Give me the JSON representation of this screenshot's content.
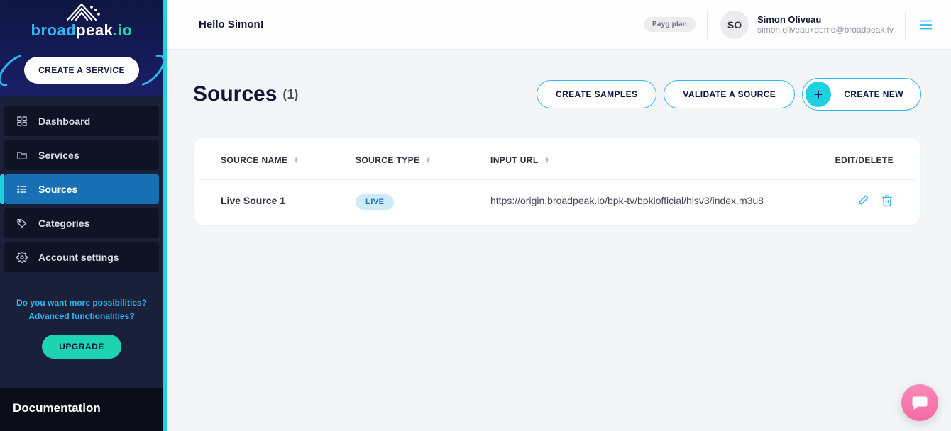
{
  "brand": {
    "left": "broad",
    "mid": "peak",
    "right": ".io"
  },
  "sidebar": {
    "create_service": "CREATE A SERVICE",
    "items": [
      {
        "label": "Dashboard"
      },
      {
        "label": "Services"
      },
      {
        "label": "Sources"
      },
      {
        "label": "Categories"
      },
      {
        "label": "Account settings"
      }
    ],
    "poss_line1": "Do you want more possibilities?",
    "poss_line2": "Advanced functionalities?",
    "upgrade": "UPGRADE",
    "documentation": "Documentation"
  },
  "topbar": {
    "hello": "Hello Simon!",
    "plan": "Payg plan",
    "user_initials": "SO",
    "user_name": "Simon Oliveau",
    "user_email": "simon.oliveau+demo@broadpeak.tv"
  },
  "page": {
    "title": "Sources",
    "count": "(1)",
    "create_samples": "CREATE SAMPLES",
    "validate": "VALIDATE A SOURCE",
    "create_new": "CREATE NEW"
  },
  "table": {
    "headers": {
      "name": "SOURCE NAME",
      "type": "SOURCE TYPE",
      "url": "INPUT URL",
      "actions": "EDIT/DELETE"
    },
    "rows": [
      {
        "name": "Live Source 1",
        "type_badge": "LIVE",
        "url": "https://origin.broadpeak.io/bpk-tv/bpkiofficial/hlsv3/index.m3u8"
      }
    ]
  }
}
